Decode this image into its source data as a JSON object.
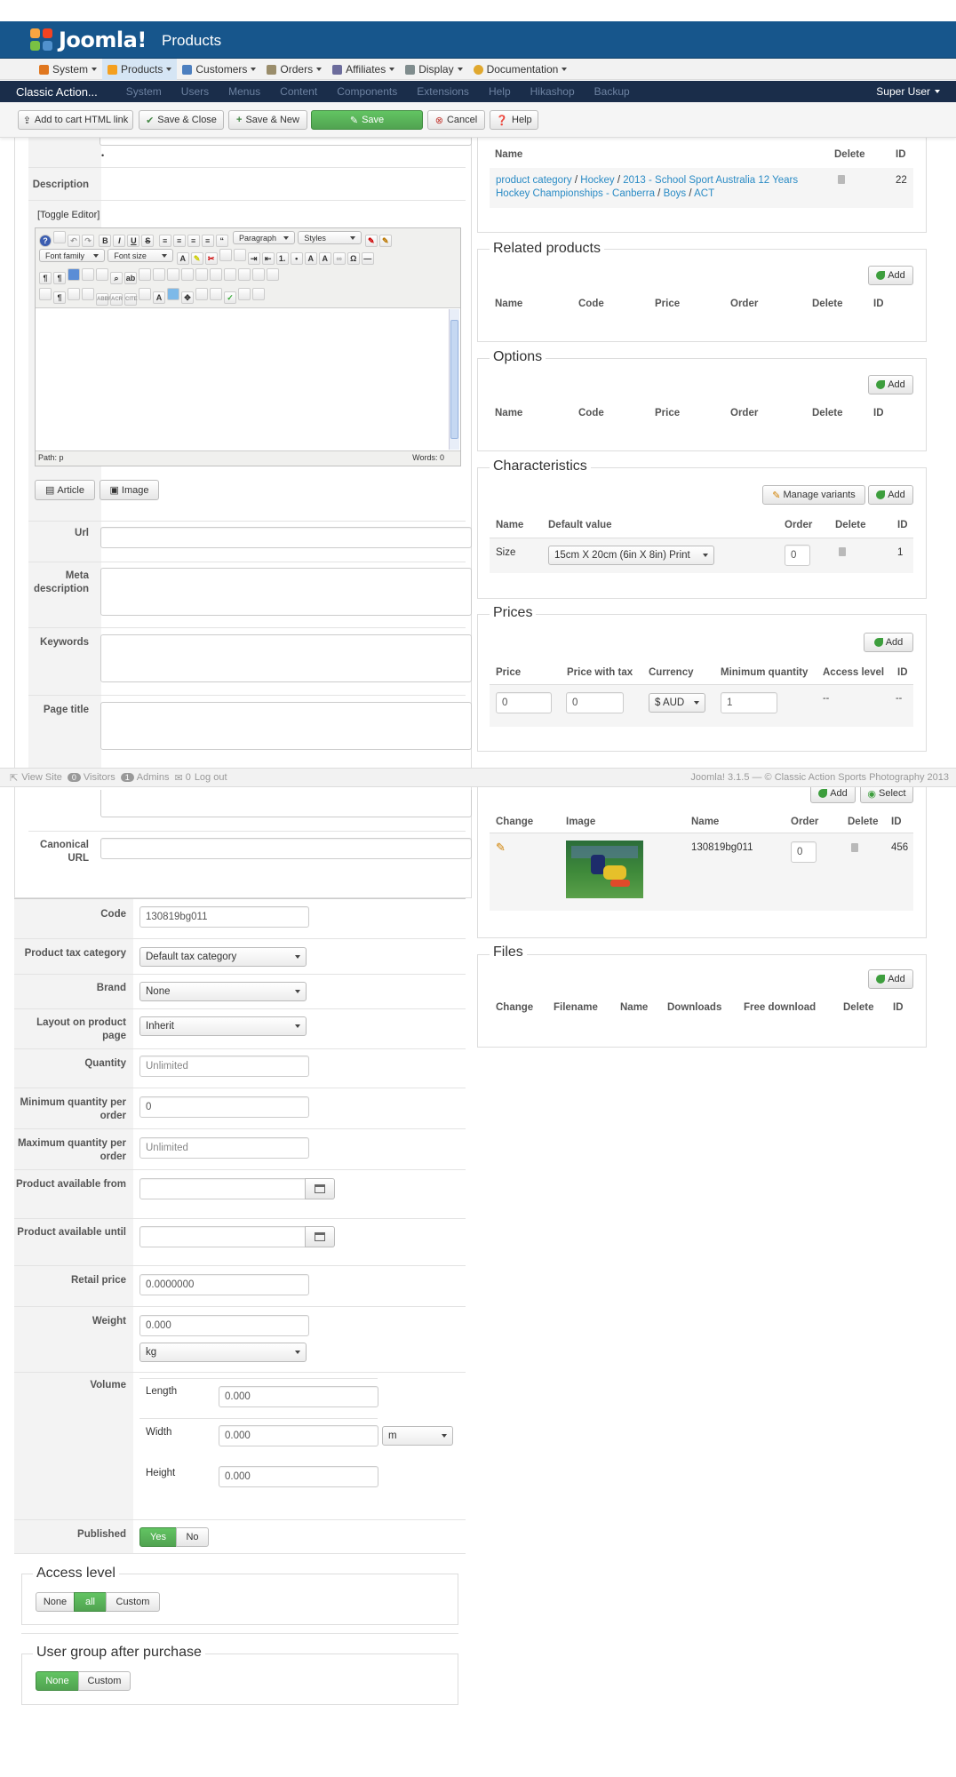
{
  "header": {
    "logo_text": "Joomla!",
    "page_title": "Products"
  },
  "main_menu": [
    "System",
    "Products",
    "Customers",
    "Orders",
    "Affiliates",
    "Display",
    "Documentation"
  ],
  "admin_bar": {
    "site_name": "Classic Action...",
    "items": [
      "System",
      "Users",
      "Menus",
      "Content",
      "Components",
      "Extensions",
      "Help",
      "Hikashop",
      "Backup"
    ],
    "user": "Super User"
  },
  "toolbar": {
    "add_to_cart": "Add to cart HTML link",
    "save_close": "Save & Close",
    "save_new": "Save & New",
    "save": "Save",
    "cancel": "Cancel",
    "help": "Help"
  },
  "left": {
    "description_label": "Description",
    "toggle_editor": "[Toggle Editor]",
    "editor": {
      "font_family": "Font family",
      "font_size": "Font size",
      "paragraph": "Paragraph",
      "styles": "Styles",
      "path_label": "Path:",
      "path_value": "p",
      "words": "Words: 0"
    },
    "article_btn": "Article",
    "image_btn": "Image",
    "url_label": "Url",
    "meta_label": "Meta description",
    "keywords_label": "Keywords",
    "page_title_label": "Page title",
    "canonical_label": "Canonical URL",
    "code_label": "Code",
    "code_value": "130819bg011",
    "tax_label": "Product tax category",
    "tax_value": "Default tax category",
    "brand_label": "Brand",
    "brand_value": "None",
    "layout_label": "Layout on product page",
    "layout_value": "Inherit",
    "quantity_label": "Quantity",
    "quantity_value": "Unlimited",
    "min_qty_label": "Minimum quantity per order",
    "min_qty_value": "0",
    "max_qty_label": "Maximum quantity per order",
    "max_qty_value": "Unlimited",
    "avail_from_label": "Product available from",
    "avail_until_label": "Product available until",
    "retail_label": "Retail price",
    "retail_value": "0.0000000",
    "weight_label": "Weight",
    "weight_value": "0.000",
    "weight_unit": "kg",
    "volume_label": "Volume",
    "length_label": "Length",
    "length_value": "0.000",
    "width_label": "Width",
    "width_value": "0.000",
    "dim_unit": "m",
    "height_label": "Height",
    "height_value": "0.000",
    "published_label": "Published",
    "yes": "Yes",
    "no": "No",
    "access_legend": "Access level",
    "access_none": "None",
    "access_all": "all",
    "access_custom": "Custom",
    "usergroup_legend": "User group after purchase",
    "ug_none": "None",
    "ug_custom": "Custom"
  },
  "right": {
    "categories": {
      "headers": [
        "Name",
        "Delete",
        "ID"
      ],
      "path": [
        "product category",
        "Hockey",
        "2013 - School Sport Australia 12 Years Hockey Championships - Canberra",
        "Boys",
        "ACT"
      ],
      "sep": " / ",
      "id": "22"
    },
    "related": {
      "legend": "Related products",
      "add": "Add",
      "headers": [
        "Name",
        "Code",
        "Price",
        "Order",
        "Delete",
        "ID"
      ]
    },
    "options": {
      "legend": "Options",
      "add": "Add",
      "headers": [
        "Name",
        "Code",
        "Price",
        "Order",
        "Delete",
        "ID"
      ]
    },
    "characteristics": {
      "legend": "Characteristics",
      "manage": "Manage variants",
      "add": "Add",
      "headers": [
        "Name",
        "Default value",
        "Order",
        "Delete",
        "ID"
      ],
      "row": {
        "name": "Size",
        "default": "15cm X 20cm (6in X 8in) Print",
        "order": "0",
        "id": "1"
      }
    },
    "prices": {
      "legend": "Prices",
      "add": "Add",
      "headers": [
        "Price",
        "Price with tax",
        "Currency",
        "Minimum quantity",
        "Access level",
        "ID"
      ],
      "row": {
        "price": "0",
        "price_tax": "0",
        "currency": "$ AUD",
        "min_qty": "1",
        "access": "--",
        "id": "--"
      }
    },
    "images": {
      "add": "Add",
      "select": "Select",
      "headers": [
        "Change",
        "Image",
        "Name",
        "Order",
        "Delete",
        "ID"
      ],
      "row": {
        "name": "130819bg011",
        "order": "0",
        "id": "456"
      }
    },
    "files": {
      "legend": "Files",
      "add": "Add",
      "headers": [
        "Change",
        "Filename",
        "Name",
        "Downloads",
        "Free download",
        "Delete",
        "ID"
      ]
    }
  },
  "status_bar": {
    "view_site": "View Site",
    "visitors_count": "0",
    "visitors": "Visitors",
    "admins_count": "1",
    "admins": "Admins",
    "messages": "0",
    "logout": "Log out",
    "version": "Joomla! 3.1.5 — © Classic Action Sports Photography 2013"
  }
}
